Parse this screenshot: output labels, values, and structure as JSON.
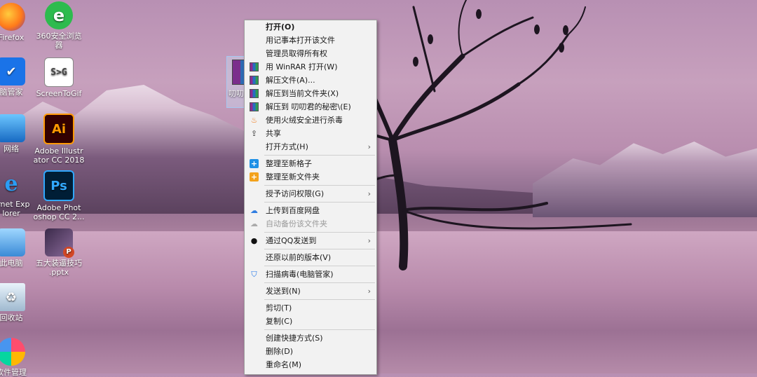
{
  "desktop": {
    "icons_left": [
      {
        "label": "Firefox"
      },
      {
        "label": "脑管家"
      },
      {
        "label": "网络"
      },
      {
        "label": "ernet Exp\nlorer"
      },
      {
        "label": "此电脑"
      },
      {
        "label": "回收站"
      },
      {
        "label": "软件管理"
      }
    ],
    "icons_second": [
      {
        "label": "360安全浏览\n器",
        "icon_text": "e"
      },
      {
        "label": "ScreenToGif",
        "icon_text": "S>G"
      },
      {
        "label": "Adobe Illustr\nator CC 2018",
        "icon_text": "Ai"
      },
      {
        "label": "Adobe Phot\noshop CC 2...",
        "icon_text": "Ps"
      },
      {
        "label": "五大装逼技巧\n.pptx",
        "icon_text": "P"
      }
    ],
    "selected_file": {
      "label": "叨叨君"
    }
  },
  "context_menu": {
    "items": [
      {
        "label": "打开(O)",
        "icon": "",
        "bold": true
      },
      {
        "label": "用记事本打开该文件",
        "icon": ""
      },
      {
        "label": "管理员取得所有权",
        "icon": ""
      },
      {
        "label": "用 WinRAR 打开(W)",
        "icon": "winrar-icon"
      },
      {
        "label": "解压文件(A)...",
        "icon": "winrar-icon"
      },
      {
        "label": "解压到当前文件夹(X)",
        "icon": "winrar-icon"
      },
      {
        "label": "解压到 叨叨君的秘密\\(E)",
        "icon": "winrar-icon"
      },
      {
        "label": "使用火绒安全进行杀毒",
        "icon": "flame-icon"
      },
      {
        "label": "共享",
        "icon": "share-icon"
      },
      {
        "label": "打开方式(H)",
        "icon": "",
        "submenu": true
      },
      {
        "label": "整理至新格子",
        "icon": "grid-blue-icon"
      },
      {
        "label": "整理至新文件夹",
        "icon": "folder-orange-icon"
      },
      {
        "label": "授予访问权限(G)",
        "icon": "",
        "submenu": true
      },
      {
        "label": "上传到百度网盘",
        "icon": "baidu-cloud-icon"
      },
      {
        "label": "自动备份该文件夹",
        "icon": "baidu-cloud-icon",
        "disabled": true
      },
      {
        "label": "通过QQ发送到",
        "icon": "qq-penguin-icon",
        "submenu": true
      },
      {
        "label": "还原以前的版本(V)",
        "icon": ""
      },
      {
        "label": "扫描病毒(电脑管家)",
        "icon": "shield-icon"
      },
      {
        "label": "发送到(N)",
        "icon": "",
        "submenu": true
      },
      {
        "label": "剪切(T)",
        "icon": ""
      },
      {
        "label": "复制(C)",
        "icon": ""
      },
      {
        "label": "创建快捷方式(S)",
        "icon": ""
      },
      {
        "label": "删除(D)",
        "icon": ""
      },
      {
        "label": "重命名(M)",
        "icon": ""
      }
    ],
    "submenu_arrow": "›",
    "colors": {
      "background": "#f2f2f2",
      "border": "#a0a0a0",
      "disabled_text": "#9a9a9a"
    }
  }
}
